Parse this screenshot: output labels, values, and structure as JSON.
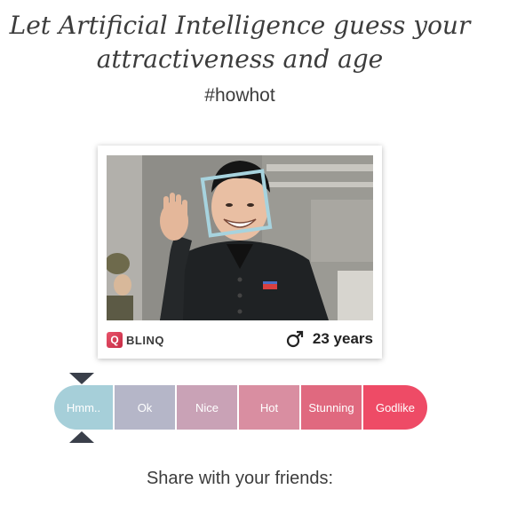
{
  "headline": {
    "line1": "Let Artificial Intelligence guess your",
    "line2": "attractiveness and age"
  },
  "hashtag": "#howhot",
  "result_card": {
    "brand_logo_letter": "Q",
    "brand_name": "BLINQ",
    "gender_icon": "male-symbol-icon",
    "age_text": "23 years"
  },
  "rating_scale": {
    "selected_index": 0,
    "segments": [
      {
        "label": "Hmm..",
        "color": "#a6cfd9"
      },
      {
        "label": "Ok",
        "color": "#b5b6c8"
      },
      {
        "label": "Nice",
        "color": "#c9a2b6"
      },
      {
        "label": "Hot",
        "color": "#d98ea1"
      },
      {
        "label": "Stunning",
        "color": "#e0697f"
      },
      {
        "label": "Godlike",
        "color": "#ee4b66"
      }
    ]
  },
  "share": {
    "label": "Share with your friends:"
  }
}
